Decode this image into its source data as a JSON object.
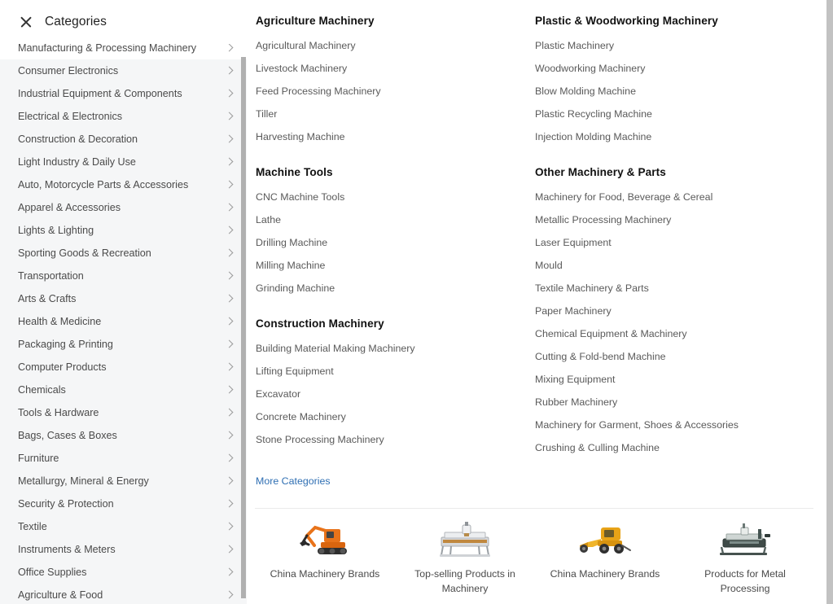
{
  "sidebar": {
    "title": "Categories",
    "close_icon": "close-icon",
    "chevron_icon": "chevron-right-icon",
    "items": [
      {
        "label": "Manufacturing & Processing Machinery",
        "active": true
      },
      {
        "label": "Consumer Electronics",
        "active": false
      },
      {
        "label": "Industrial Equipment & Components",
        "active": false
      },
      {
        "label": "Electrical & Electronics",
        "active": false
      },
      {
        "label": "Construction & Decoration",
        "active": false
      },
      {
        "label": "Light Industry & Daily Use",
        "active": false
      },
      {
        "label": "Auto, Motorcycle Parts & Accessories",
        "active": false
      },
      {
        "label": "Apparel & Accessories",
        "active": false
      },
      {
        "label": "Lights & Lighting",
        "active": false
      },
      {
        "label": "Sporting Goods & Recreation",
        "active": false
      },
      {
        "label": "Transportation",
        "active": false
      },
      {
        "label": "Arts & Crafts",
        "active": false
      },
      {
        "label": "Health & Medicine",
        "active": false
      },
      {
        "label": "Packaging & Printing",
        "active": false
      },
      {
        "label": "Computer Products",
        "active": false
      },
      {
        "label": "Chemicals",
        "active": false
      },
      {
        "label": "Tools & Hardware",
        "active": false
      },
      {
        "label": "Bags, Cases & Boxes",
        "active": false
      },
      {
        "label": "Furniture",
        "active": false
      },
      {
        "label": "Metallurgy, Mineral & Energy",
        "active": false
      },
      {
        "label": "Security & Protection",
        "active": false
      },
      {
        "label": "Textile",
        "active": false
      },
      {
        "label": "Instruments & Meters",
        "active": false
      },
      {
        "label": "Office Supplies",
        "active": false
      },
      {
        "label": "Agriculture & Food",
        "active": false
      }
    ]
  },
  "panel": {
    "columns": [
      {
        "groups": [
          {
            "title": "Agriculture Machinery",
            "items": [
              "Agricultural Machinery",
              "Livestock Machinery",
              "Feed Processing Machinery",
              "Tiller",
              "Harvesting Machine"
            ]
          },
          {
            "title": "Machine Tools",
            "items": [
              "CNC Machine Tools",
              "Lathe",
              "Drilling Machine",
              "Milling Machine",
              "Grinding Machine"
            ]
          },
          {
            "title": "Construction Machinery",
            "items": [
              "Building Material Making Machinery",
              "Lifting Equipment",
              "Excavator",
              "Concrete Machinery",
              "Stone Processing Machinery"
            ]
          }
        ],
        "more_link": "More Categories"
      },
      {
        "groups": [
          {
            "title": "Plastic & Woodworking Machinery",
            "items": [
              "Plastic Machinery",
              "Woodworking Machinery",
              "Blow Molding Machine",
              "Plastic Recycling Machine",
              "Injection Molding Machine"
            ]
          },
          {
            "title": "Other Machinery & Parts",
            "items": [
              "Machinery for Food, Beverage & Cereal",
              "Metallic Processing Machinery",
              "Laser Equipment",
              "Mould",
              "Textile Machinery & Parts",
              "Paper Machinery",
              "Chemical Equipment & Machinery",
              "Cutting & Fold-bend Machine",
              "Mixing Equipment",
              "Rubber Machinery",
              "Machinery for Garment, Shoes & Accessories",
              "Crushing & Culling Machine"
            ]
          }
        ]
      }
    ],
    "promos": [
      {
        "label": "China Machinery Brands",
        "icon": "excavator-image"
      },
      {
        "label": "Top-selling Products in Machinery",
        "icon": "cnc-router-image"
      },
      {
        "label": "China Machinery Brands",
        "icon": "loader-machine-image"
      },
      {
        "label": "Products for Metal Processing",
        "icon": "metal-cutting-machine-image"
      }
    ]
  },
  "colors": {
    "sidebar_bg": "#f5f6f7",
    "panel_bg": "#ffffff",
    "link_blue": "#2f6fb3",
    "text_dark": "#222222",
    "text_muted": "#5a5a5a",
    "scrollbar": "#b0b0b0"
  }
}
